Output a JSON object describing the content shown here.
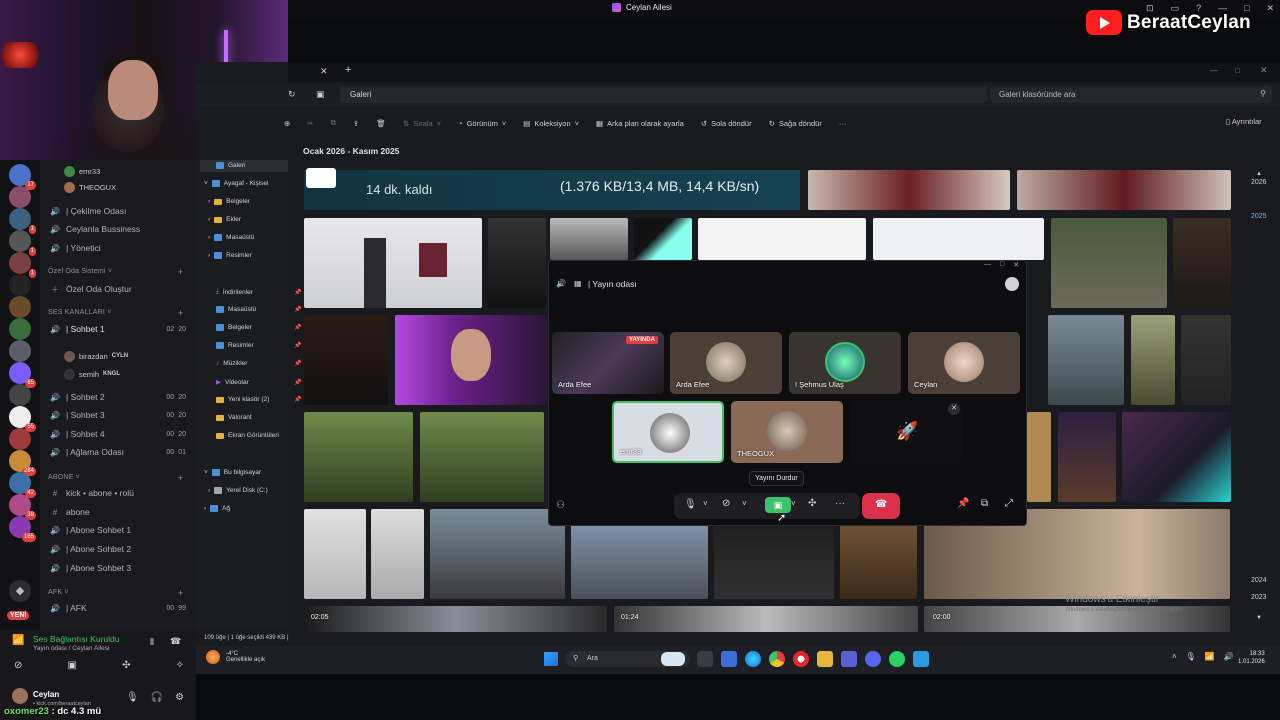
{
  "top": {
    "window_title": "Ceylan Ailesi",
    "channel_badge": "BeraatCeylan"
  },
  "discord": {
    "servers_counts": [
      "17",
      "1",
      "1",
      "1",
      "65",
      "55",
      "284",
      "42",
      "38",
      "165"
    ],
    "new_badge": "YENİ",
    "users_top": [
      "emr33",
      "THEOGUX"
    ],
    "channels": [
      {
        "name": "| Çekilme Odası",
        "icon": "speaker-icon"
      },
      {
        "name": "Ceylanla Bussiness",
        "icon": "speaker-icon"
      },
      {
        "name": "| Yönetici",
        "icon": "speaker-icon"
      }
    ],
    "cat_private": "Özel Oda Sistemi",
    "create_room": "Özel Oda Oluştur",
    "cat_voice": "SES KANALLARI",
    "sohbet1": {
      "name": "| Sohbet 1",
      "a": "02",
      "b": "20"
    },
    "voice_users": [
      {
        "name": "birazdan",
        "tag": "CYLN"
      },
      {
        "name": "semih",
        "tag": "KNGL"
      }
    ],
    "sohbet2": {
      "name": "| Sohbet 2",
      "a": "00",
      "b": "20"
    },
    "sohbet3": {
      "name": "| Sohbet 3",
      "a": "00",
      "b": "20"
    },
    "sohbet4": {
      "name": "| Sohbet 4",
      "a": "00",
      "b": "20"
    },
    "aglama": {
      "name": "| Ağlama Odası",
      "a": "00",
      "b": "01"
    },
    "cat_abone": "ABONE",
    "abone_channels": [
      "kick • abone • rolü",
      "abone",
      "| Abone Sohbet 1",
      "| Abone Sohbet 2",
      "| Abone Sohbet 3"
    ],
    "cat_afk": "AFK",
    "afk": {
      "name": "| AFK",
      "a": "00",
      "b": "99"
    },
    "voice_status": "Ses Bağlantısı Kuruldu",
    "voice_sub": "Yayın odası / Ceylan Ailesi",
    "me_name": "Ceylan",
    "me_sub": "• kick.com/beraatceylan",
    "overlay_user": "oxomer23",
    "overlay_msg": ": dc 4.3 mü"
  },
  "explorer": {
    "address": "Galeri",
    "search_placeholder": "Galeri klasöründe ara",
    "toolbar": {
      "sort": "Sırala",
      "view": "Görünüm",
      "collection": "Koleksiyon",
      "set_bg": "Arka plan olarak ayarla",
      "rotate_left": "Sola döndür",
      "rotate_right": "Sağa döndür",
      "details": "Ayrıntılar"
    },
    "group_header": "Ocak 2026 - Kasım 2025",
    "nav": {
      "gallery": "Galeri",
      "home": "Ayagaf - Kişisel",
      "docs": "Belgeler",
      "attachments": "Ekler",
      "desktop": "Masaüstü",
      "pictures": "Resimler",
      "downloads": "İndirilenler",
      "desktop2": "Masaüstü",
      "docs2": "Belgeler",
      "pictures2": "Resimler",
      "music": "Müzikler",
      "videos": "Videolar",
      "new_folder": "Yeni klasör (2)",
      "valorant": "Valorant",
      "screenshots": "Ekran Görüntüleri",
      "this_pc": "Bu bilgisayar",
      "local_disk": "Yerel Disk (C:)",
      "network": "Ağ"
    },
    "download_banner": {
      "left": "14 dk. kaldı",
      "right": "(1.376 KB/13,4 MB, 14,4 KB/sn)"
    },
    "video_durations": [
      "02:05",
      "01:24",
      "02:00"
    ],
    "timeline": [
      "2026",
      "2025",
      "2024",
      "2023"
    ],
    "status": "109 öğe  |  1 öğe seçildi  439 KB  |",
    "watermark_title": "Windows'u Etkinleştir",
    "watermark_sub": "Windows'u etkinleştirmek için Ayarlar'a gidin."
  },
  "taskbar": {
    "temp": "-4°C",
    "weather": "Genellikle açık",
    "search": "Ara",
    "time": "18:33",
    "date": "1.01.2026"
  },
  "call": {
    "title": "| Yayın odası",
    "live_tag": "YAYINDA",
    "participants": [
      "Arda Efee",
      "Arda Efee",
      "! Şehmus Ulaş",
      "Ceylan",
      "emr33",
      "THEOGUX"
    ],
    "tooltip": "Yayını Durdur",
    "accent": "#3cc36b",
    "end_color": "#d9304b"
  }
}
